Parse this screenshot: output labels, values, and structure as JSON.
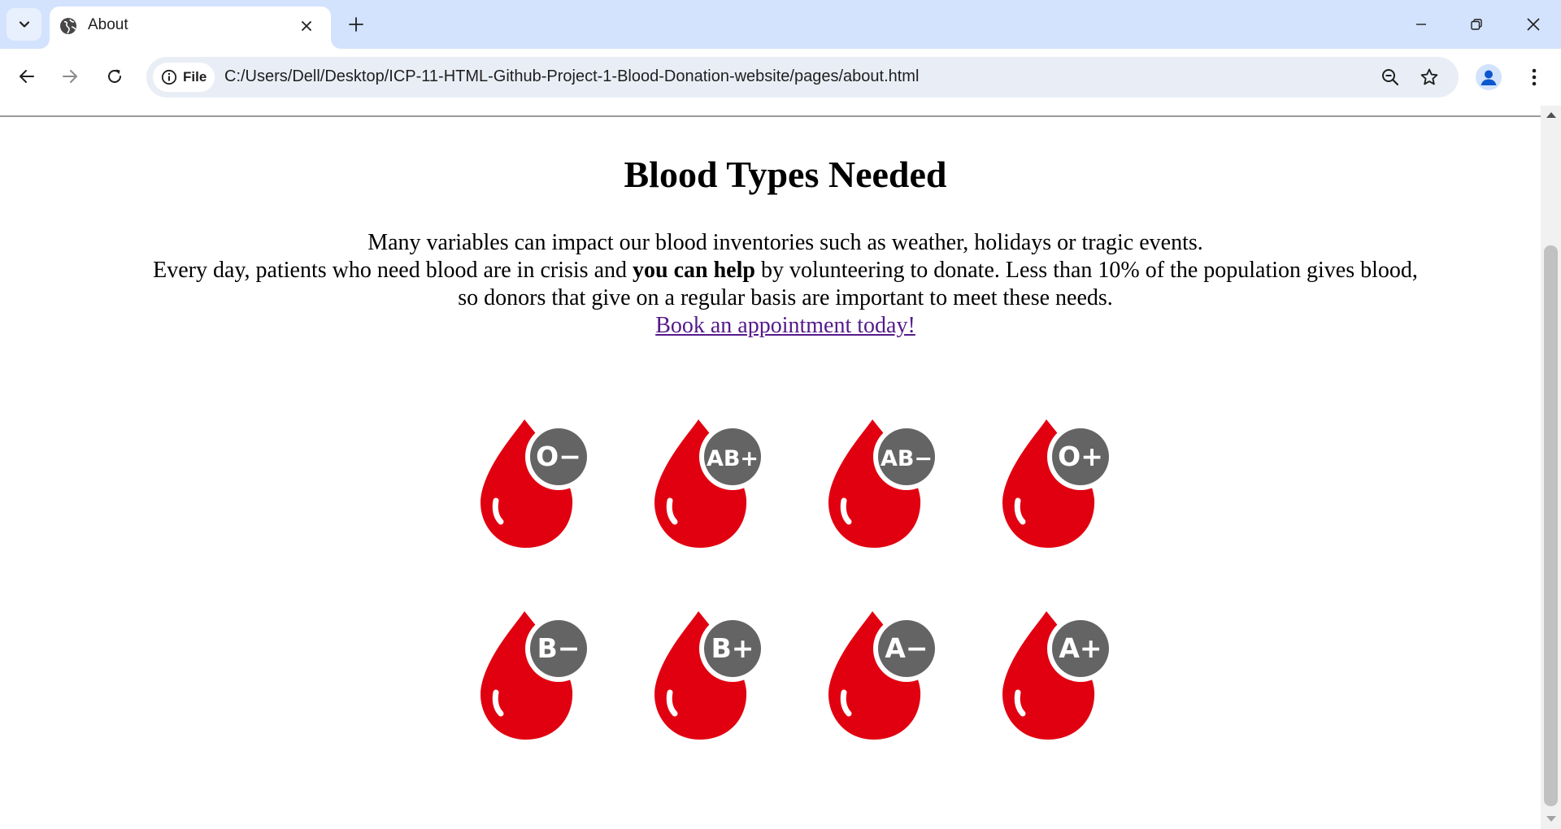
{
  "browser": {
    "tab": {
      "title": "About",
      "favicon": "globe-icon"
    },
    "address_bar": {
      "site_chip_label": "File",
      "url": "C:/Users/Dell/Desktop/ICP-11-HTML-Github-Project-1-Blood-Donation-website/pages/about.html"
    },
    "icons": {
      "tab_search": "chevron-down-icon",
      "tab_close": "close-icon",
      "new_tab": "plus-icon",
      "back": "arrow-left-icon",
      "forward": "arrow-right-icon",
      "reload": "reload-icon",
      "site_info": "info-icon",
      "zoom": "zoom-out-icon",
      "bookmark": "star-icon",
      "profile": "person-icon",
      "menu": "more-vertical-icon",
      "minimize": "minimize-icon",
      "restore": "restore-icon",
      "close_window": "close-icon"
    },
    "colors": {
      "tabstrip": "#d3e3fd",
      "omnibox": "#e9eef6"
    }
  },
  "page": {
    "heading": "Blood Types Needed",
    "intro": {
      "line1": "Many variables can impact our blood inventories such as weather, holidays or tragic events.",
      "line2_before": "Every day, patients who need blood are in crisis and",
      "line2_bold": "you can help",
      "line2_after": "by volunteering to donate. Less than 10% of the population gives blood,",
      "line3": "so donors that give on a regular basis are important to meet these needs.",
      "link": "Book an appointment today!"
    },
    "blood_types": [
      "O−",
      "AB+",
      "AB−",
      "O+",
      "B−",
      "B+",
      "A−",
      "A+"
    ],
    "colors": {
      "drop": "#e10010",
      "badge": "#646464",
      "link": "#551a8b"
    }
  }
}
